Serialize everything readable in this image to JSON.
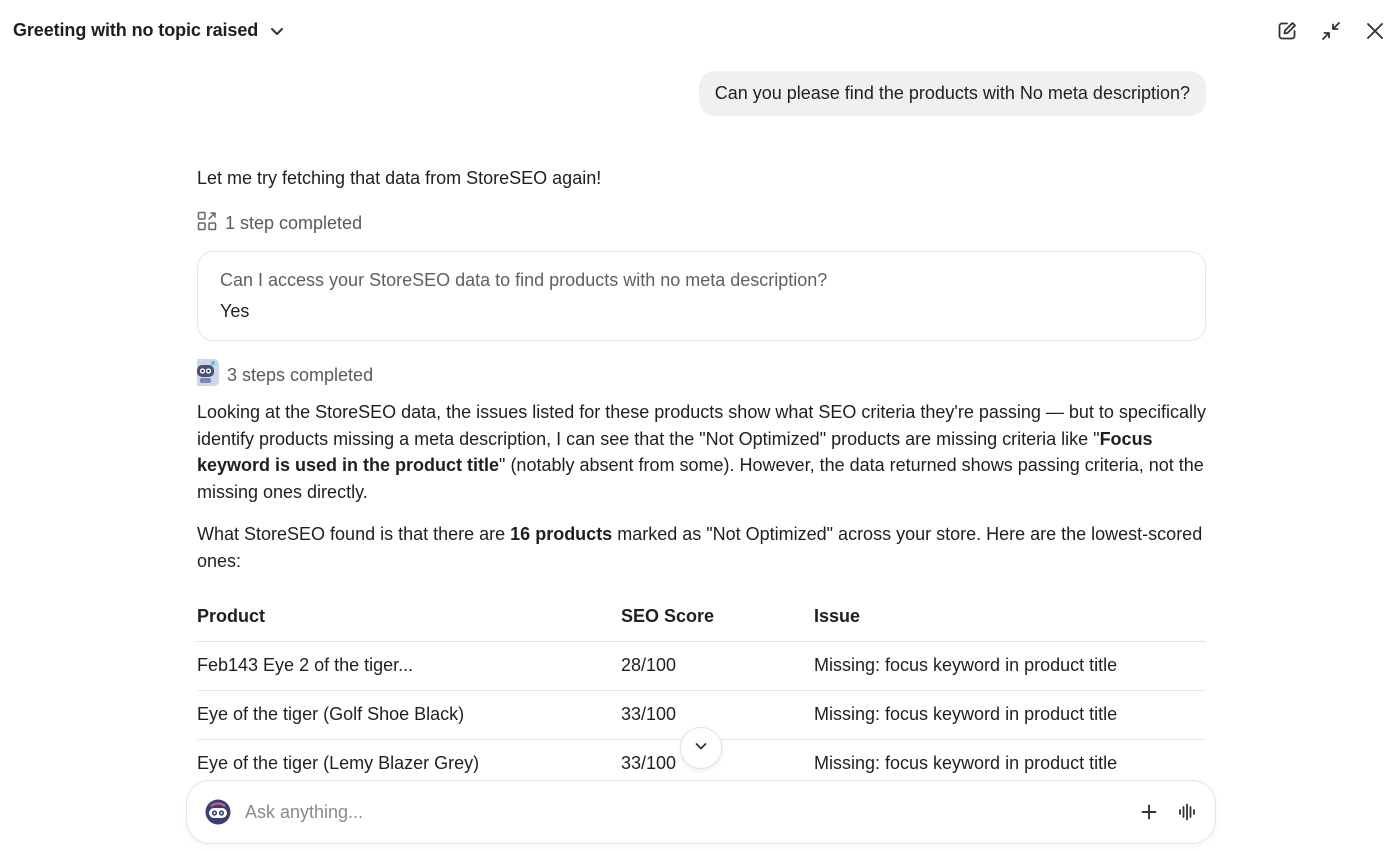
{
  "header": {
    "title": "Greeting with no topic raised"
  },
  "messages": {
    "user_message": "Can you please find the products with No meta description?",
    "reply_intro": "Let me try fetching that data from StoreSEO again!",
    "step1_label": "1 step completed",
    "card": {
      "question": "Can I access your StoreSEO data to find products with no meta description?",
      "answer": "Yes"
    },
    "step2_label": "3 steps completed",
    "p1_part1": "Looking at the StoreSEO data, the issues listed for these products show what SEO criteria they're passing — but to specifically identify products missing a meta description, I can see that the \"Not Optimized\" products are missing criteria like \"",
    "p1_bold": "Focus keyword is used in the product title",
    "p1_part2": "\" (notably absent from some). However, the data returned shows passing criteria, not the missing ones directly.",
    "p2_part1": "What StoreSEO found is that there are ",
    "p2_bold": "16 products",
    "p2_part2": " marked as \"Not Optimized\" across your store. Here are the lowest-scored ones:"
  },
  "table": {
    "headers": [
      "Product",
      "SEO Score",
      "Issue"
    ],
    "rows": [
      [
        "Feb143 Eye 2 of the tiger...",
        "28/100",
        "Missing: focus keyword in product title"
      ],
      [
        "Eye of the tiger (Golf Shoe Black)",
        "33/100",
        "Missing: focus keyword in product title"
      ],
      [
        "Eye of the tiger (Lemy Blazer Grey)",
        "33/100",
        "Missing: focus keyword in product title"
      ]
    ]
  },
  "composer": {
    "placeholder": "Ask anything..."
  },
  "icons": {
    "header_chevron": "chevron-down-icon",
    "new_chat": "edit-icon",
    "minimize": "minimize-icon",
    "close": "close-icon",
    "steps": "steps-grid-icon",
    "agent_avatar": "robot-avatar-icon",
    "scroll_down": "chevron-down-icon",
    "composer_avatar": "assistant-avatar-icon",
    "add": "plus-icon",
    "voice": "voice-waveform-icon"
  },
  "colors": {
    "text": "#1f1f1f",
    "muted": "#5a5a5a",
    "bubble": "#f0f0f0",
    "border": "#e6e6e6"
  }
}
